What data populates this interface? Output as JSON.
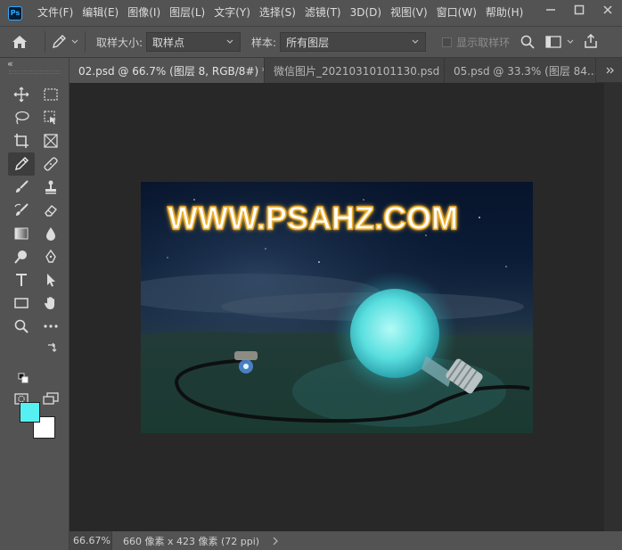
{
  "app": {
    "logo": "Ps"
  },
  "menu": [
    "文件(F)",
    "编辑(E)",
    "图像(I)",
    "图层(L)",
    "文字(Y)",
    "选择(S)",
    "滤镜(T)",
    "3D(D)",
    "视图(V)",
    "窗口(W)",
    "帮助(H)"
  ],
  "options": {
    "sample_size_label": "取样大小:",
    "sample_size_value": "取样点",
    "sample_label": "样本:",
    "sample_value": "所有图层",
    "show_ring_label": "显示取样环"
  },
  "tabs": [
    {
      "label": "02.psd @ 66.7% (图层 8, RGB/8#) *",
      "active": true
    },
    {
      "label": "微信图片_20210310101130.psd",
      "active": false
    },
    {
      "label": "05.psd @ 33.3% (图层 84...",
      "active": false
    }
  ],
  "document": {
    "watermark": "WWW.PSAHZ.COM"
  },
  "status": {
    "zoom": "66.67%",
    "info": "660 像素 x 423 像素 (72 ppi)"
  },
  "colors": {
    "foreground": "#56f0f2",
    "background": "#ffffff",
    "accent": "#31a8ff"
  }
}
